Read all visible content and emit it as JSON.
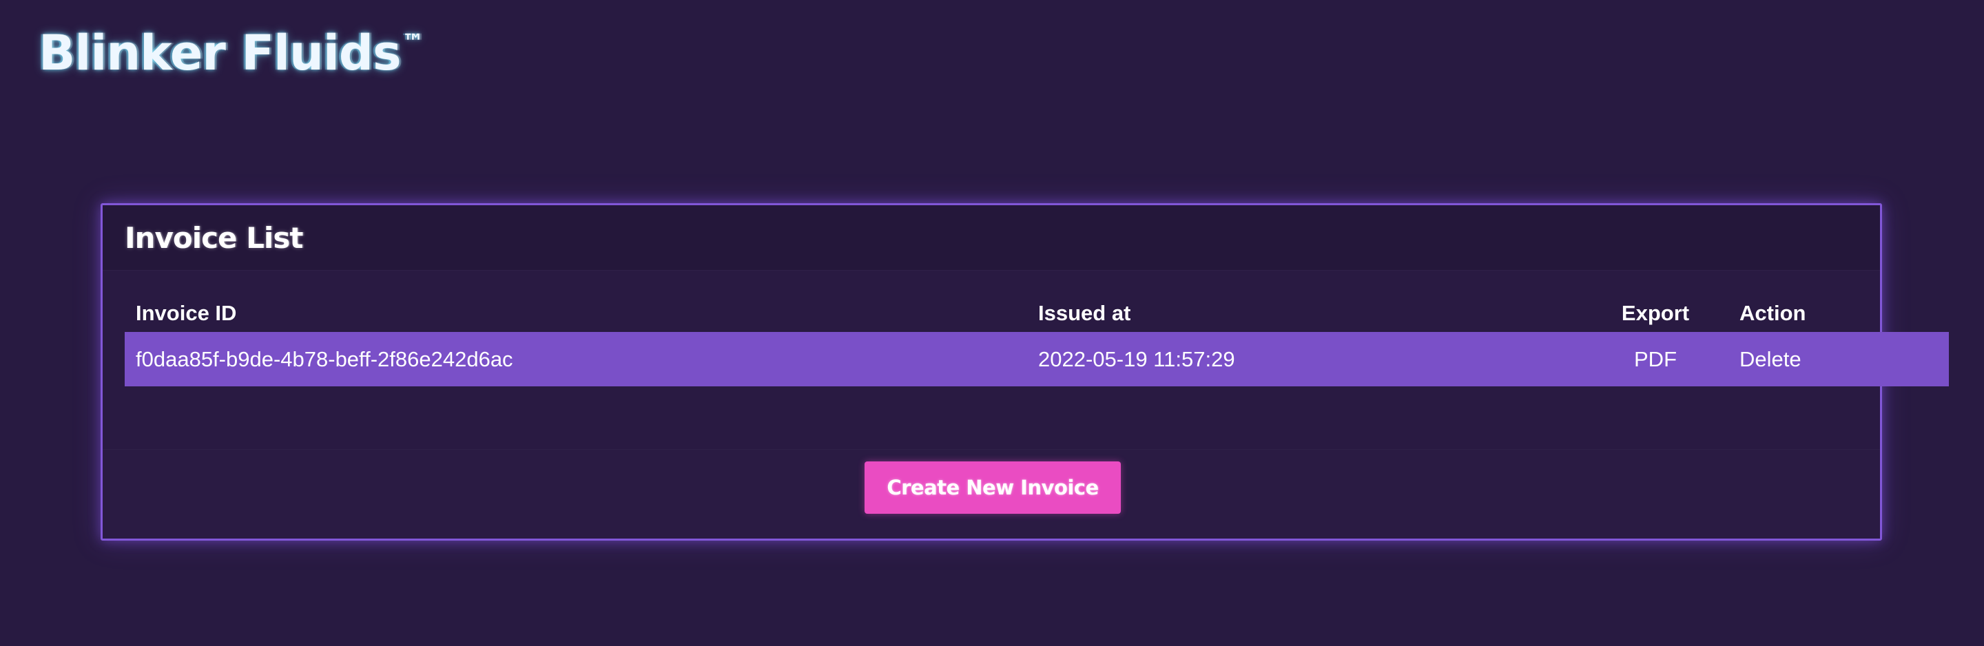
{
  "brand": {
    "name": "Blinker Fluids",
    "trademark": "™"
  },
  "invoice_list": {
    "title": "Invoice List",
    "columns": [
      "Invoice ID",
      "Issued at",
      "Export",
      "Action"
    ],
    "rows": [
      {
        "invoice_id": "f0daa85f-b9de-4b78-beff-2f86e242d6ac",
        "issued_at": "2022-05-19 11:57:29",
        "export": "PDF",
        "action": "Delete"
      }
    ],
    "create_button": "Create New Invoice"
  },
  "colors": {
    "background": "#281a41",
    "panel_border": "#8257d8",
    "row_highlight": "#7a50c8",
    "button": "#ea4cc2",
    "brand_glow": "#7ae8ff"
  }
}
